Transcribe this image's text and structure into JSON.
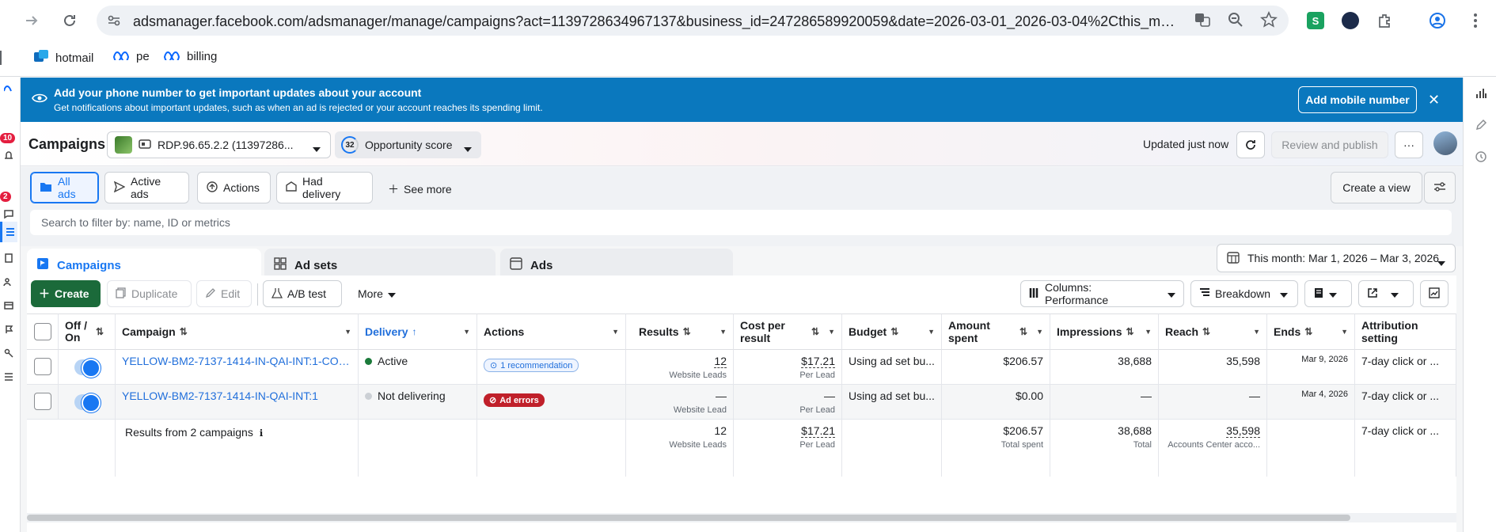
{
  "browser": {
    "url": "adsmanager.facebook.com/adsmanager/manage/campaigns?act=1139728634967137&business_id=247286589920059&date=2026-03-01_2026-03-04%2Cthis_month&c...",
    "bookmarks": [
      {
        "label": "hotmail",
        "icon": "outlook-icon"
      },
      {
        "label": "pe",
        "icon": "meta-icon"
      },
      {
        "label": "billing",
        "icon": "meta-icon"
      }
    ]
  },
  "left_rail": {
    "badge_1": "10",
    "badge_2": "2"
  },
  "banner": {
    "title": "Add your phone number to get important updates about your account",
    "subtitle": "Get notifications about important updates, such as when an ad is rejected or your account reaches its spending limit.",
    "button": "Add mobile number"
  },
  "header": {
    "title": "Campaigns",
    "account": "RDP.96.65.2.2 (11397286...",
    "opportunity_score_value": "32",
    "opportunity_score_label": "Opportunity score",
    "updated": "Updated just now",
    "review_button": "Review and publish"
  },
  "filters": {
    "chips": [
      "All ads",
      "Active ads",
      "Actions",
      "Had delivery"
    ],
    "see_more": "See more",
    "create_view": "Create a view",
    "search_placeholder": "Search to filter by: name, ID or metrics"
  },
  "tabs": [
    "Campaigns",
    "Ad sets",
    "Ads"
  ],
  "date_range": "This month: Mar 1, 2026 – Mar 3, 2026",
  "toolbar": {
    "create": "Create",
    "duplicate": "Duplicate",
    "edit": "Edit",
    "ab_test": "A/B test",
    "more": "More",
    "columns": "Columns: Performance",
    "breakdown": "Breakdown"
  },
  "table": {
    "headers": {
      "off_on": "Off / On",
      "campaign": "Campaign",
      "delivery": "Delivery",
      "actions": "Actions",
      "results": "Results",
      "cost_per_result": "Cost per result",
      "budget": "Budget",
      "amount_spent": "Amount spent",
      "impressions": "Impressions",
      "reach": "Reach",
      "ends": "Ends",
      "attribution": "Attribution setting"
    },
    "rows": [
      {
        "campaign": "YELLOW-BM2-7137-1414-IN-QAI-INT:1-COP...",
        "delivery": "Active",
        "action": "1 recommendation",
        "results": "12",
        "results_sub": "Website Leads",
        "cost": "$17.21",
        "cost_sub": "Per Lead",
        "budget": "Using ad set bu...",
        "spent": "$206.57",
        "impressions": "38,688",
        "reach": "35,598",
        "ends": "Mar 9, 2026",
        "attribution": "7-day click or ..."
      },
      {
        "campaign": "YELLOW-BM2-7137-1414-IN-QAI-INT:1",
        "delivery": "Not delivering",
        "action": "Ad errors",
        "results": "—",
        "results_sub": "Website Lead",
        "cost": "—",
        "cost_sub": "Per Lead",
        "budget": "Using ad set bu...",
        "spent": "$0.00",
        "impressions": "—",
        "reach": "—",
        "ends": "Mar 4, 2026",
        "attribution": "7-day click or ..."
      }
    ],
    "summary": {
      "label": "Results from 2 campaigns",
      "results": "12",
      "results_sub": "Website Leads",
      "cost": "$17.21",
      "cost_sub": "Per Lead",
      "spent": "$206.57",
      "spent_sub": "Total spent",
      "impressions": "38,688",
      "impressions_sub": "Total",
      "reach": "35,598",
      "reach_sub": "Accounts Center acco...",
      "attribution": "7-day click or ..."
    }
  },
  "colors": {
    "banner": "#0a78be",
    "primary_green": "#1b6a3a",
    "link_blue": "#216fdb",
    "active_green": "#1b7a3a",
    "error_red": "#c0202a"
  }
}
